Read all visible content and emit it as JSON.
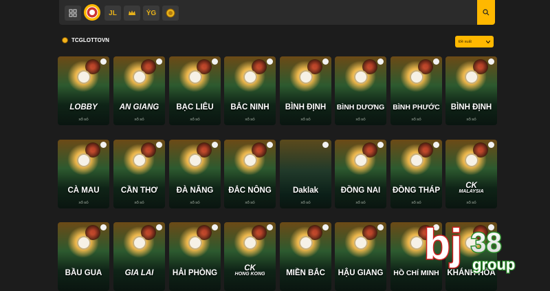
{
  "topbar": {
    "providers": [
      {
        "icon": "grid-icon",
        "label": ""
      },
      {
        "icon": "tc-lotto-icon",
        "label": ""
      },
      {
        "icon": "jl-icon",
        "label": "JL"
      },
      {
        "icon": "crown-icon",
        "label": ""
      },
      {
        "icon": "yg-icon",
        "label": "ẎG"
      },
      {
        "icon": "coin-icon",
        "label": ""
      }
    ],
    "search_icon": "search-icon"
  },
  "filter": {
    "brand": "TCGLOTTOVN",
    "sort_label": "Đề xuất"
  },
  "colors": {
    "accent": "#ffb800",
    "background": "#1c1c1c",
    "topbar": "#2b2b2b"
  },
  "games": [
    {
      "title": "LOBBY",
      "sub": "XỔ SỐ",
      "style": "italic"
    },
    {
      "title": "AN GIANG",
      "sub": "XỔ SỐ",
      "style": "italic"
    },
    {
      "title": "BẠC LIÊU",
      "sub": "XỔ SỐ",
      "style": "normal"
    },
    {
      "title": "BẮC NINH",
      "sub": "XỔ SỐ",
      "style": "normal"
    },
    {
      "title": "BÌNH ĐỊNH",
      "sub": "XỔ SỐ",
      "style": "normal"
    },
    {
      "title": "BÌNH DƯƠNG",
      "sub": "XỔ SỐ",
      "style": "normal"
    },
    {
      "title": "BÌNH PHƯỚC",
      "sub": "XỔ SỐ",
      "style": "normal"
    },
    {
      "title": "BÌNH ĐỊNH",
      "sub": "XỔ SỐ",
      "style": "normal"
    },
    {
      "title": "CÀ MAU",
      "sub": "XỔ SỐ",
      "style": "normal"
    },
    {
      "title": "CẦN THƠ",
      "sub": "XỔ SỐ",
      "style": "normal"
    },
    {
      "title": "ĐÀ NẴNG",
      "sub": "XỔ SỐ",
      "style": "normal"
    },
    {
      "title": "ĐẮC NÔNG",
      "sub": "XỔ SỐ",
      "style": "normal"
    },
    {
      "title": "Daklak",
      "sub": "XỔ SỐ",
      "style": "plain"
    },
    {
      "title": "ĐỒNG NAI",
      "sub": "XỔ SỐ",
      "style": "normal"
    },
    {
      "title": "ĐỒNG THÁP",
      "sub": "XỔ SỐ",
      "style": "normal"
    },
    {
      "title": "CK",
      "title2": "MALAYSIA",
      "sub": "XỔ SỐ",
      "style": "italic"
    },
    {
      "title": "BẦU GUA",
      "sub": "",
      "style": "normal"
    },
    {
      "title": "GIA LAI",
      "sub": "",
      "style": "italic"
    },
    {
      "title": "HẢI PHÒNG",
      "sub": "",
      "style": "normal"
    },
    {
      "title": "CK",
      "title2": "HONG KONG",
      "sub": "",
      "style": "italic"
    },
    {
      "title": "MIỀN BẮC",
      "sub": "",
      "style": "normal"
    },
    {
      "title": "HẬU GIANG",
      "sub": "",
      "style": "normal"
    },
    {
      "title": "HỒ CHÍ MINH",
      "sub": "",
      "style": "normal"
    },
    {
      "title": "KHÁNH HÒA",
      "sub": "",
      "style": "normal"
    }
  ],
  "watermark": {
    "text_main": "bj38",
    "text_sub": "group"
  }
}
